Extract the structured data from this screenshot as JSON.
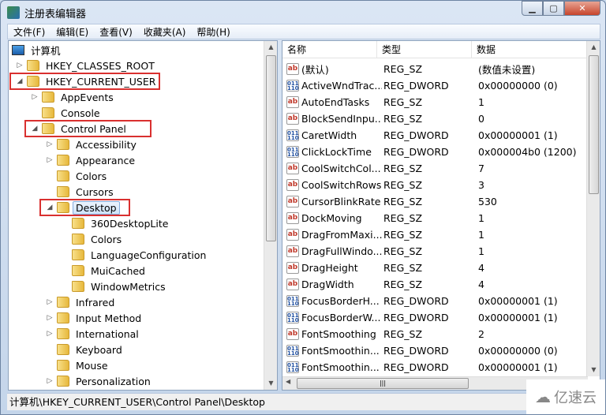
{
  "window": {
    "title": "注册表编辑器",
    "icon": "regedit-icon",
    "controls": [
      "minimize",
      "maximize",
      "close"
    ]
  },
  "menu": [
    "文件(F)",
    "编辑(E)",
    "查看(V)",
    "收藏夹(A)",
    "帮助(H)"
  ],
  "tree": [
    {
      "label": "计算机",
      "level": 0,
      "state": "expanded",
      "icon": "computer-icon"
    },
    {
      "label": "HKEY_CLASSES_ROOT",
      "level": 1,
      "state": "collapsed"
    },
    {
      "label": "HKEY_CURRENT_USER",
      "level": 1,
      "state": "expanded",
      "highlighted": true
    },
    {
      "label": "AppEvents",
      "level": 2,
      "state": "collapsed"
    },
    {
      "label": "Console",
      "level": 2,
      "state": "none"
    },
    {
      "label": "Control Panel",
      "level": 2,
      "state": "expanded",
      "highlighted": true
    },
    {
      "label": "Accessibility",
      "level": 3,
      "state": "collapsed"
    },
    {
      "label": "Appearance",
      "level": 3,
      "state": "collapsed"
    },
    {
      "label": "Colors",
      "level": 3,
      "state": "none"
    },
    {
      "label": "Cursors",
      "level": 3,
      "state": "none"
    },
    {
      "label": "Desktop",
      "level": 3,
      "state": "expanded",
      "highlighted": true,
      "selected": true
    },
    {
      "label": "360DesktopLite",
      "level": 4,
      "state": "none"
    },
    {
      "label": "Colors",
      "level": 4,
      "state": "none"
    },
    {
      "label": "LanguageConfiguration",
      "level": 4,
      "state": "none"
    },
    {
      "label": "MuiCached",
      "level": 4,
      "state": "none"
    },
    {
      "label": "WindowMetrics",
      "level": 4,
      "state": "none"
    },
    {
      "label": "Infrared",
      "level": 3,
      "state": "collapsed"
    },
    {
      "label": "Input Method",
      "level": 3,
      "state": "collapsed"
    },
    {
      "label": "International",
      "level": 3,
      "state": "collapsed"
    },
    {
      "label": "Keyboard",
      "level": 3,
      "state": "none"
    },
    {
      "label": "Mouse",
      "level": 3,
      "state": "none"
    },
    {
      "label": "Personalization",
      "level": 3,
      "state": "collapsed"
    }
  ],
  "list": {
    "columns": [
      "名称",
      "类型",
      "数据"
    ],
    "rows": [
      {
        "name": "(默认)",
        "type": "REG_SZ",
        "data": "(数值未设置)"
      },
      {
        "name": "ActiveWndTrac...",
        "type": "REG_DWORD",
        "data": "0x00000000 (0)"
      },
      {
        "name": "AutoEndTasks",
        "type": "REG_SZ",
        "data": "1"
      },
      {
        "name": "BlockSendInpu...",
        "type": "REG_SZ",
        "data": "0"
      },
      {
        "name": "CaretWidth",
        "type": "REG_DWORD",
        "data": "0x00000001 (1)"
      },
      {
        "name": "ClickLockTime",
        "type": "REG_DWORD",
        "data": "0x000004b0 (1200)"
      },
      {
        "name": "CoolSwitchCol...",
        "type": "REG_SZ",
        "data": "7"
      },
      {
        "name": "CoolSwitchRows",
        "type": "REG_SZ",
        "data": "3"
      },
      {
        "name": "CursorBlinkRate",
        "type": "REG_SZ",
        "data": "530"
      },
      {
        "name": "DockMoving",
        "type": "REG_SZ",
        "data": "1"
      },
      {
        "name": "DragFromMaxi...",
        "type": "REG_SZ",
        "data": "1"
      },
      {
        "name": "DragFullWindo...",
        "type": "REG_SZ",
        "data": "1"
      },
      {
        "name": "DragHeight",
        "type": "REG_SZ",
        "data": "4"
      },
      {
        "name": "DragWidth",
        "type": "REG_SZ",
        "data": "4"
      },
      {
        "name": "FocusBorderH...",
        "type": "REG_DWORD",
        "data": "0x00000001 (1)"
      },
      {
        "name": "FocusBorderW...",
        "type": "REG_DWORD",
        "data": "0x00000001 (1)"
      },
      {
        "name": "FontSmoothing",
        "type": "REG_SZ",
        "data": "2"
      },
      {
        "name": "FontSmoothin...",
        "type": "REG_DWORD",
        "data": "0x00000000 (0)"
      },
      {
        "name": "FontSmoothin...",
        "type": "REG_DWORD",
        "data": "0x00000001 (1)"
      }
    ]
  },
  "status": "计算机\\HKEY_CURRENT_USER\\Control Panel\\Desktop",
  "watermark": "亿速云",
  "colors": {
    "highlight_box": "#d9302f",
    "selection": "#cfe4fa"
  }
}
